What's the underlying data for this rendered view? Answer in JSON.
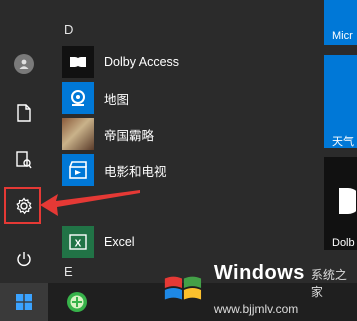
{
  "sections": {
    "d_letter": "D",
    "e_letter": "E"
  },
  "apps": [
    {
      "label": "Dolby Access",
      "icon": "dolby-icon"
    },
    {
      "label": "地图",
      "icon": "maps-icon"
    },
    {
      "label": "帝国霸略",
      "icon": "game-thumbnail-icon"
    },
    {
      "label": "电影和电视",
      "icon": "movies-tv-icon"
    },
    {
      "label": "Excel",
      "icon": "excel-icon"
    }
  ],
  "sidebar": {
    "items": [
      {
        "name": "user-avatar",
        "icon": "user-icon"
      },
      {
        "name": "documents",
        "icon": "document-icon"
      },
      {
        "name": "pictures",
        "icon": "pictures-icon"
      },
      {
        "name": "settings",
        "icon": "gear-icon"
      },
      {
        "name": "power",
        "icon": "power-icon"
      }
    ]
  },
  "tiles": {
    "top_label": "Micr",
    "weather_label": "天气",
    "dolby_label": "Dolb"
  },
  "watermark": {
    "title": "Windows",
    "subtitle": "系统之家",
    "url": "www.bjjmlv.com"
  },
  "colors": {
    "accent_blue": "#0078d7",
    "highlight_red": "#e53935",
    "excel_green": "#217346"
  }
}
